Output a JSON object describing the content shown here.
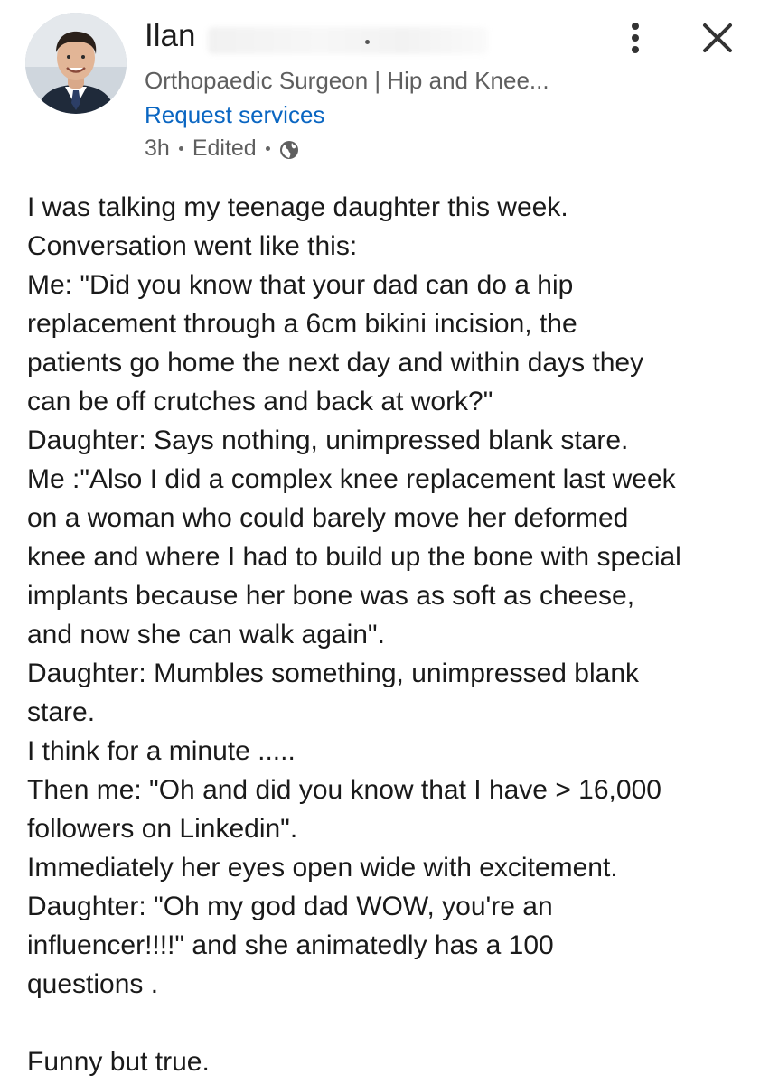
{
  "author": {
    "name": "Ilan",
    "headline": "Orthopaedic Surgeon | Hip and Knee...",
    "action_link": "Request services"
  },
  "meta": {
    "time": "3h",
    "edited": "Edited",
    "visibility_icon": "globe-icon"
  },
  "header_actions": {
    "more_icon": "vertical-ellipsis-icon",
    "close_icon": "close-icon"
  },
  "post_lines": [
    "I was talking my teenage daughter this week.",
    "Conversation went like this:",
    "Me: \"Did you know that your dad can do a hip",
    "replacement through a 6cm bikini incision, the",
    "patients go home the next day and within days they",
    "can be off crutches and back at work?\"",
    "Daughter:  Says nothing, unimpressed blank stare.",
    "Me :\"Also I did a complex knee replacement last week",
    "on a woman who could barely move her deformed",
    "knee and where I had to build up the bone with special",
    "implants because her bone was as soft as cheese,",
    "and now she can walk again\".",
    "Daughter: Mumbles something, unimpressed blank",
    "stare.",
    "I think for a minute .....",
    "Then me: \"Oh and did you know that I have > 16,000",
    "followers on Linkedin\".",
    "Immediately her eyes open wide with excitement.",
    "Daughter: \"Oh my god dad WOW, you're an",
    "influencer!!!!\" and she animatedly has a 100",
    "questions .",
    "",
    "Funny but true."
  ],
  "colors": {
    "link": "#0a66c2",
    "secondary_text": "#5f5f5f",
    "body_text": "#1a1a1a"
  }
}
